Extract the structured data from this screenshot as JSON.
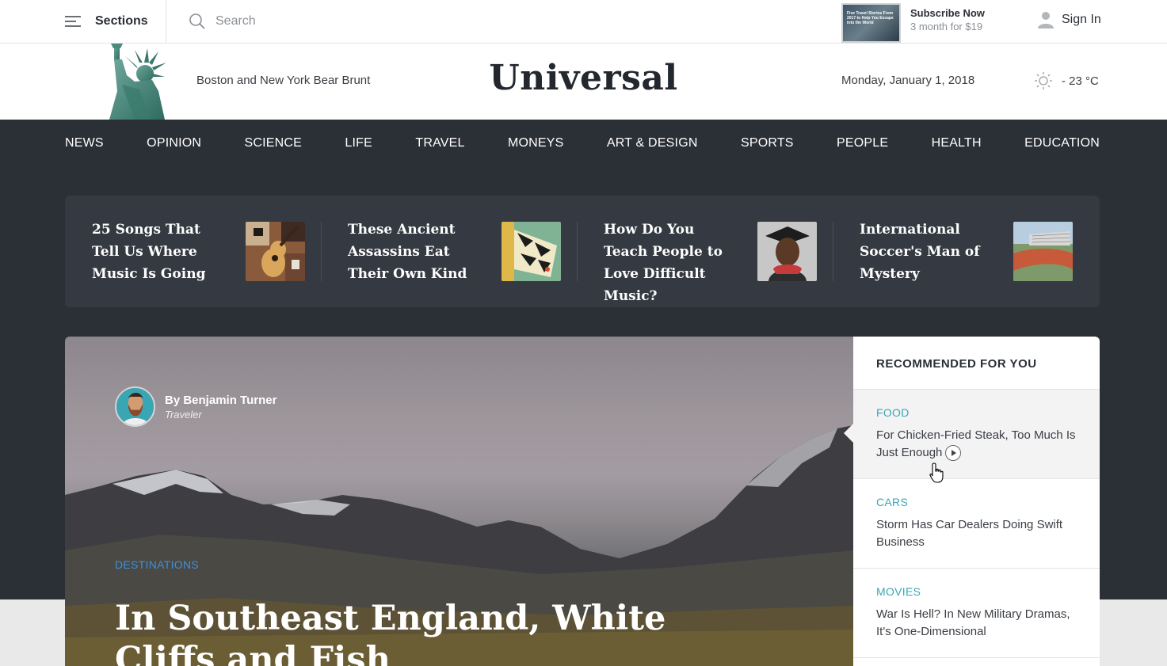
{
  "topbar": {
    "sections_label": "Sections",
    "search_placeholder": "Search",
    "subscribe_thumb_text": "Five Travel Stories From 2017 to Help You Escape into the World",
    "subscribe_title": "Subscribe Now",
    "subscribe_offer": "3 month for $19",
    "signin_label": "Sign In"
  },
  "masthead": {
    "tagline": "Boston and New York Bear Brunt",
    "logo": "Universal",
    "date": "Monday, January 1, 2018",
    "temperature": "- 23 °C"
  },
  "nav": {
    "items": [
      "NEWS",
      "OPINION",
      "SCIENCE",
      "LIFE",
      "TRAVEL",
      "MONEYS",
      "ART & DESIGN",
      "SPORTS",
      "PEOPLE",
      "HEALTH",
      "EDUCATION"
    ]
  },
  "top_stories": [
    {
      "title": "25 Songs That Tell Us Where Music Is Going",
      "image": "guitar-thumbnail"
    },
    {
      "title": "These Ancient Assassins Eat Their Own Kind",
      "image": "butterfly-thumbnail"
    },
    {
      "title": "How Do You Teach People to Love Difficult Music?",
      "image": "portrait-thumbnail"
    },
    {
      "title": "International Soccer's Man of Mystery",
      "image": "stadium-thumbnail"
    }
  ],
  "hero": {
    "author": "By Benjamin Turner",
    "author_role": "Traveler",
    "category": "DESTINATIONS",
    "title": "In Southeast England, White Cliffs and Fish"
  },
  "recommended": {
    "heading": "RECOMMENDED FOR YOU",
    "items": [
      {
        "category": "FOOD",
        "title": "For Chicken-Fried Steak, Too Much Is Just Enough",
        "has_video": true
      },
      {
        "category": "CARS",
        "title": "Storm Has Car Dealers Doing Swift Business",
        "has_video": false
      },
      {
        "category": "MOVIES",
        "title": "War Is Hell? In New Military Dramas, It's One-Dimensional",
        "has_video": false
      }
    ]
  },
  "colors": {
    "dark_bg": "#2b2f36",
    "strip_bg": "#353a42",
    "rec_category": "#3aa6b4",
    "hero_category": "#3f8fe0"
  }
}
